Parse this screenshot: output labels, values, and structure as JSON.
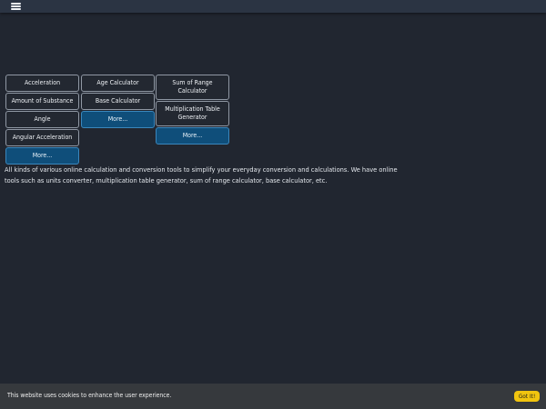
{
  "header": {
    "menu_icon": "hamburger-menu-icon"
  },
  "tool_columns": [
    {
      "buttons": [
        "Acceleration",
        "Amount of Substance",
        "Angle",
        "Angular Acceleration"
      ],
      "more_label": "More..."
    },
    {
      "buttons": [
        "Age Calculator",
        "Base Calculator"
      ],
      "more_label": "More..."
    },
    {
      "buttons": [
        "Sum of Range Calculator",
        "Multiplication Table Generator"
      ],
      "more_label": "More..."
    }
  ],
  "description": "All kinds of various online calculation and conversion tools to simplify your everyday conversion and calculations. We have online tools such as units converter, multiplication table generator, sum of range calculator, base calculator, etc.",
  "cookie_banner": {
    "message": "This website uses cookies to enhance the user experience.",
    "button_label": "Got It!"
  },
  "colors": {
    "page_background": "#212630",
    "topbar_background": "#2b3443",
    "more_button": "#0f4e7a",
    "cookie_bar": "#36393d",
    "cookie_button": "#f1c40f"
  }
}
